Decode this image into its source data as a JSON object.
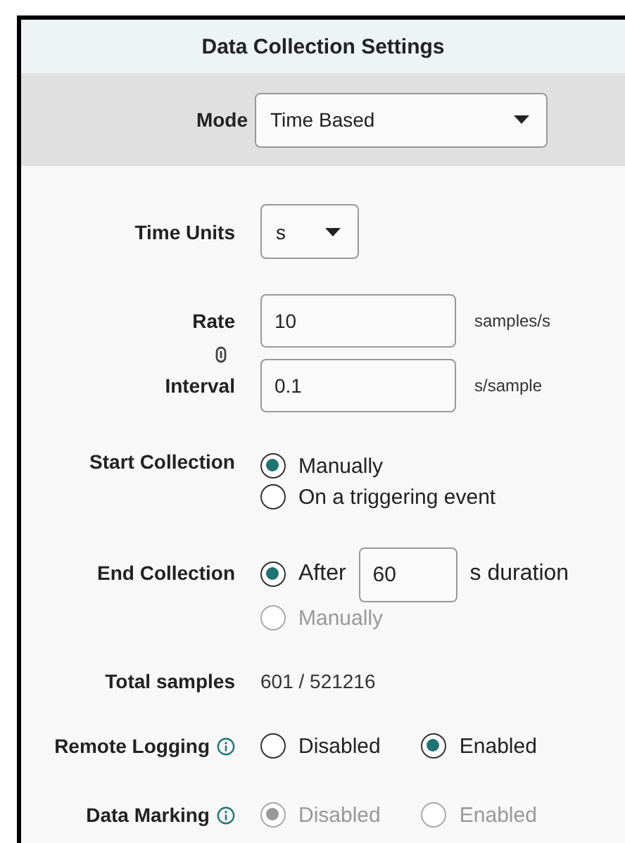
{
  "title": "Data Collection Settings",
  "mode": {
    "label": "Mode",
    "value": "Time Based"
  },
  "time_units": {
    "label": "Time Units",
    "value": "s"
  },
  "rate": {
    "label": "Rate",
    "value": "10",
    "unit": "samples/s"
  },
  "interval": {
    "label": "Interval",
    "value": "0.1",
    "unit": "s/sample"
  },
  "start_collection": {
    "label": "Start Collection",
    "options": [
      {
        "label": "Manually",
        "selected": true,
        "disabled": false
      },
      {
        "label": "On a triggering event",
        "selected": false,
        "disabled": false
      }
    ]
  },
  "end_collection": {
    "label": "End Collection",
    "options": [
      {
        "kind": "duration",
        "label": "After",
        "value": "60",
        "unit": "s duration",
        "selected": true,
        "disabled": false
      },
      {
        "kind": "plain",
        "label": "Manually",
        "selected": false,
        "disabled": true
      }
    ]
  },
  "total_samples": {
    "label": "Total samples",
    "value": "601 / 521216"
  },
  "remote_logging": {
    "label": "Remote Logging",
    "options": [
      {
        "label": "Disabled",
        "selected": false,
        "disabled": false
      },
      {
        "label": "Enabled",
        "selected": true,
        "disabled": false
      }
    ]
  },
  "data_marking": {
    "label": "Data Marking",
    "options": [
      {
        "label": "Disabled",
        "selected": true,
        "disabled": true
      },
      {
        "label": "Enabled",
        "selected": false,
        "disabled": true
      }
    ]
  }
}
